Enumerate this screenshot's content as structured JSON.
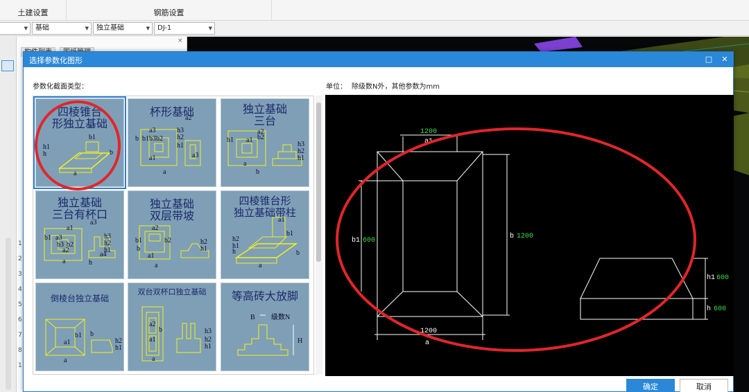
{
  "ribbon": {
    "civil_settings": "土建设置",
    "rebar_settings": "钢筋设置"
  },
  "toolbar": {
    "combo_category": "基础",
    "combo_type": "独立基础",
    "combo_name": "DJ-1"
  },
  "left_panel": {
    "tab_components": "构件列表",
    "tab_drawings": "图纸管理",
    "row_numbers": [
      "1",
      "2",
      "3",
      "4",
      "5",
      "6",
      "7",
      "8",
      "1"
    ]
  },
  "dialog": {
    "title": "选择参数化图形",
    "section_label": "参数化截面类型：",
    "unit_label": "单位：",
    "unit_text": "除级数N外，其他参数为mm",
    "ok_label": "确定",
    "cancel_label": "取消",
    "thumbnails": [
      {
        "title": "四棱锥台\n形独立基础",
        "labels": [
          "a1",
          "b1",
          "h1",
          "h",
          "b",
          "a"
        ]
      },
      {
        "title": "杯形基础",
        "labels": [
          "a2",
          "b",
          "b1",
          "b3",
          "b2",
          "a3",
          "h3",
          "h2",
          "h1",
          "a1",
          "a3",
          "a"
        ]
      },
      {
        "title": "独立基础\n三台",
        "labels": [
          "a2",
          "b2",
          "a1",
          "b1",
          "a",
          "b",
          "h3",
          "h2",
          "h1"
        ]
      },
      {
        "title": "独立基础\n三台有杯口",
        "labels": [
          "a1",
          "a3",
          "b1",
          "a3",
          "b3",
          "b2",
          "a2",
          "a",
          "a4",
          "h3",
          "h2",
          "h1",
          "h"
        ]
      },
      {
        "title": "独立基础\n双层带坡",
        "labels": [
          "a2",
          "b1",
          "b2",
          "a1",
          "b",
          "a",
          "h2",
          "h1"
        ]
      },
      {
        "title": "四棱锥台形\n独立基础带柱",
        "labels": [
          "a1",
          "b1",
          "h2",
          "h1",
          "h",
          "a",
          "b"
        ]
      },
      {
        "title": "倒棱台独立基础",
        "labels": [
          "a1",
          "b1",
          "b",
          "a",
          "h2",
          "h1"
        ]
      },
      {
        "title": "双台双杯口独立基础",
        "labels": [
          "a2",
          "a1",
          "b",
          "a",
          "h3",
          "h2",
          "h1"
        ]
      },
      {
        "title": "等高砖大放脚",
        "labels": [
          "B",
          "级数N",
          "H"
        ]
      }
    ],
    "preview": {
      "a1_value": "1200",
      "a1_label": "a1",
      "b1_label": "b1",
      "b1_value": "600",
      "b_label": "b",
      "b_value": "1200",
      "a_value": "1200",
      "a_label": "a",
      "h1_label": "h1",
      "h1_value": "600",
      "h_label": "h",
      "h_value": "600"
    }
  },
  "colors": {
    "titlebar": "#2b88d8",
    "thumb_bg": "#7f9fb6",
    "thumb_text": "#1b2a6b",
    "thumb_line": "#f2f21a",
    "annotation_red": "#e0262b",
    "dim_green": "#3ee04a"
  }
}
